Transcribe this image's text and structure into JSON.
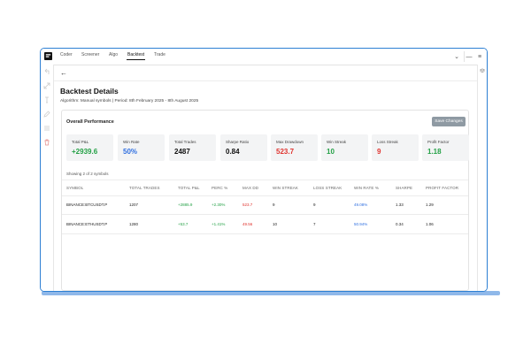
{
  "topbar": {
    "tabs": [
      {
        "label": "Coder"
      },
      {
        "label": "Screener"
      },
      {
        "label": "Algo"
      },
      {
        "label": "Backtest",
        "active": true
      },
      {
        "label": "Trade"
      }
    ],
    "chevron_glyph": "⌄",
    "minimize_glyph": "—",
    "menu_glyph": "≡"
  },
  "sidebar": {
    "icons": [
      "undo-icon",
      "expand-icon",
      "text-cursor-icon",
      "pencil-icon",
      "lines-icon",
      "trash-icon"
    ]
  },
  "header": {
    "back_glyph": "←",
    "title": "Backtest Details",
    "subtitle": "Algorithm: Manual symbols | Period: 8th February 2025 - 8th August 2025"
  },
  "performance": {
    "title": "Overall Performance",
    "save_button": "Save Changes",
    "metrics": [
      {
        "label": "Total P&L",
        "value": "+2939.6",
        "color": "#23a045"
      },
      {
        "label": "Win Rate",
        "value": "50%",
        "color": "#2f6fe0"
      },
      {
        "label": "Total Trades",
        "value": "2487",
        "color": "#111111"
      },
      {
        "label": "Sharpe Ratio",
        "value": "0.84",
        "color": "#111111"
      },
      {
        "label": "Max Drawdown",
        "value": "523.7",
        "color": "#e0342f"
      },
      {
        "label": "Win Streak",
        "value": "10",
        "color": "#23a045"
      },
      {
        "label": "Loss Streak",
        "value": "9",
        "color": "#e0342f"
      },
      {
        "label": "Profit Factor",
        "value": "1.18",
        "color": "#23a045"
      }
    ]
  },
  "table": {
    "showing": "Showing 2 of 2 symbols",
    "headers": [
      "SYMBOL",
      "TOTAL TRADES",
      "TOTAL P&L",
      "PERC %",
      "MAX DD",
      "WIN STREAK",
      "LOSS STREAK",
      "WIN RATE %",
      "SHARPE",
      "PROFIT FACTOR"
    ],
    "rows": [
      [
        "BINANCE:BTCUSDT.P",
        "1207",
        "+2885.9",
        "+2.30%",
        "523.7",
        "9",
        "9",
        "49.08%",
        "1.33",
        "1.29"
      ],
      [
        "BINANCE:ETHUSDT.P",
        "1280",
        "+53.7",
        "+1.41%",
        "49.56",
        "10",
        "7",
        "50.94%",
        "0.34",
        "1.06"
      ]
    ],
    "colors": {
      "green": "#23a045",
      "red": "#e0342f",
      "blue": "#2f6fe0"
    }
  }
}
